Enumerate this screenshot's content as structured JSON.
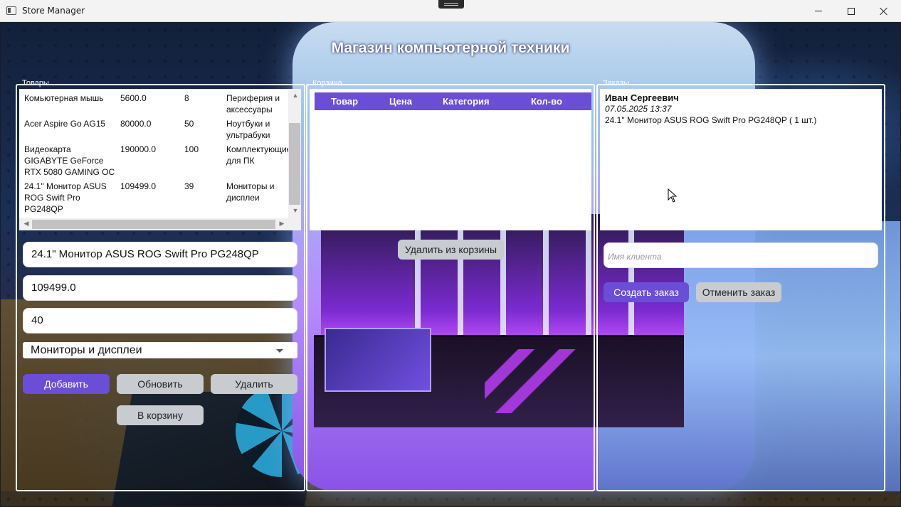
{
  "window": {
    "title": "Store Manager"
  },
  "header": {
    "title": "Магазин компьютерной техники"
  },
  "groups": {
    "products": "Товары",
    "cart": "Корзина",
    "orders": "Заказы"
  },
  "products": {
    "rows": [
      {
        "name": "Комьютерная мышь",
        "price": "5600.0",
        "qty": "8",
        "category": "Периферия и аксессуары"
      },
      {
        "name": "Acer Aspire Go AG15",
        "price": "80000.0",
        "qty": "50",
        "category": "Ноутбуки и ультрабуки"
      },
      {
        "name": "Видеокарта GIGABYTE GeForce RTX 5080 GAMING OC",
        "price": "190000.0",
        "qty": "100",
        "category": "Комплектующие для ПК"
      },
      {
        "name": "24.1\" Монитор ASUS ROG Swift Pro PG248QP",
        "price": "109499.0",
        "qty": "39",
        "category": "Мониторы и дисплеи"
      }
    ]
  },
  "form": {
    "name_value": "24.1\" Монитор ASUS ROG Swift Pro PG248QP",
    "price_value": "109499.0",
    "qty_value": "40",
    "category_selected": "Мониторы и дисплеи",
    "add_label": "Добавить",
    "update_label": "Обновить",
    "delete_label": "Удалить",
    "to_cart_label": "В корзину"
  },
  "cart": {
    "columns": [
      "Товар",
      "Цена",
      "Категория",
      "Кол-во"
    ],
    "remove_label": "Удалить из корзины"
  },
  "orders": {
    "items": [
      {
        "client": "Иван Сергеевич",
        "date": "07.05.2025 13:37",
        "line": "24.1\" Монитор ASUS ROG Swift Pro PG248QP  ( 1  шт.)"
      }
    ],
    "client_placeholder": "Имя клиента",
    "create_label": "Создать заказ",
    "cancel_label": "Отменить заказ"
  },
  "colors": {
    "accent": "#6a4ed6",
    "button_gray": "#c8cbd0"
  }
}
